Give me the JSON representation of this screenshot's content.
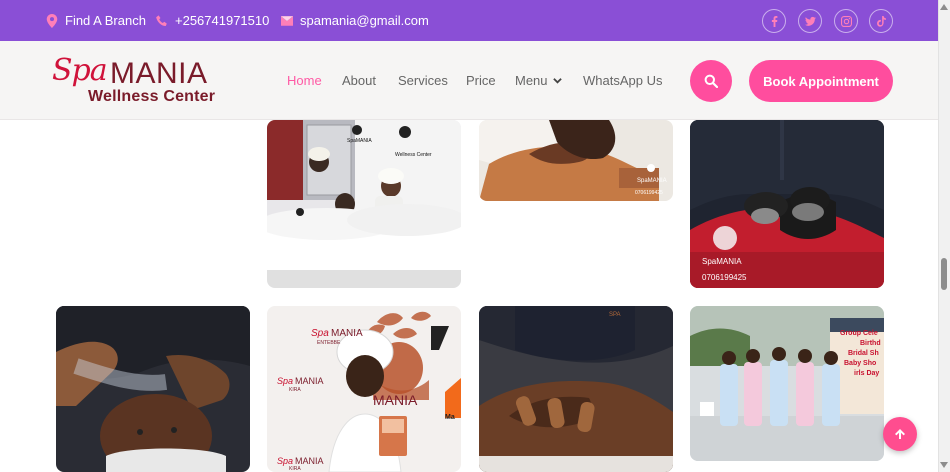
{
  "topbar": {
    "branch_label": "Find A Branch",
    "phone": "+256741971510",
    "email": "spamania@gmail.com",
    "icons": [
      "map-pin-icon",
      "phone-icon",
      "envelope-icon",
      "facebook-icon",
      "twitter-icon",
      "instagram-icon",
      "tiktok-icon"
    ]
  },
  "brand": {
    "logo_spa": "Spa",
    "logo_mania": "MANIA",
    "logo_sub": "Wellness Center"
  },
  "nav": {
    "items": [
      {
        "label": "Home",
        "active": true
      },
      {
        "label": "About"
      },
      {
        "label": "Services"
      },
      {
        "label": "Price"
      },
      {
        "label": "Menu",
        "has_dropdown": true
      },
      {
        "label": "WhatsApp Us"
      }
    ],
    "book_label": "Book Appointment"
  },
  "gallery": {
    "phone_watermark": "0706199425",
    "spa_watermark": "SpaMANIA",
    "wellness_watermark": "Wellness Center",
    "poster_spa": "Spa",
    "poster_mania": "MANIA",
    "poster_kira": "KIRA",
    "poster_entebbe": "ENTEBBE",
    "poster_ma": "Ma",
    "poster_text_lines": [
      "Group Cele",
      "Birthd",
      "Bridal Sh",
      "Baby Sho",
      "irls Day"
    ]
  },
  "colors": {
    "topbar_bg": "#8a4fd6",
    "accent_pink": "#ff4d9e",
    "brand_red": "#d0123a",
    "brand_maroon": "#7a1b2a",
    "nav_active": "#ff5aa5"
  }
}
